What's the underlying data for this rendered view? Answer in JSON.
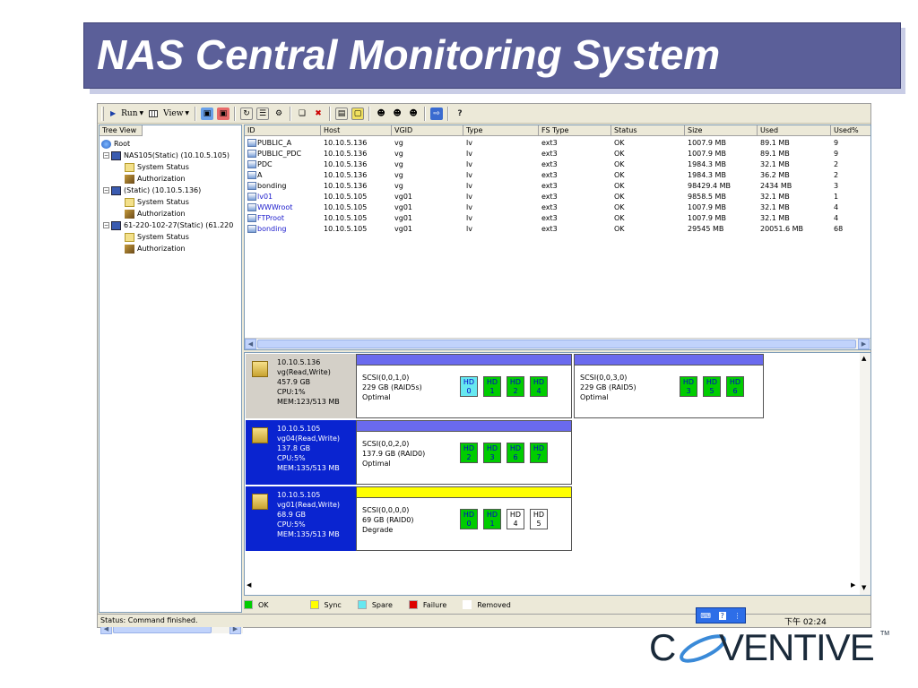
{
  "slide": {
    "title": "NAS Central Monitoring System"
  },
  "toolbar": {
    "run_label": "Run",
    "view_label": "View"
  },
  "tree": {
    "header": "Tree View",
    "items": [
      {
        "label": "Root"
      },
      {
        "label": "NAS105(Static) (10.10.5.105)"
      },
      {
        "label": "System Status"
      },
      {
        "label": "Authorization"
      },
      {
        "label": "(Static) (10.10.5.136)"
      },
      {
        "label": "System Status"
      },
      {
        "label": "Authorization"
      },
      {
        "label": "61-220-102-27(Static) (61.220"
      },
      {
        "label": "System Status"
      },
      {
        "label": "Authorization"
      }
    ]
  },
  "table": {
    "columns": [
      "ID",
      "Host",
      "VGID",
      "Type",
      "FS Type",
      "Status",
      "Size",
      "Used",
      "Used%"
    ],
    "rows": [
      [
        "PUBLIC_A",
        "10.10.5.136",
        "vg",
        "lv",
        "ext3",
        "OK",
        "1007.9 MB",
        "89.1 MB",
        "9"
      ],
      [
        "PUBLIC_PDC",
        "10.10.5.136",
        "vg",
        "lv",
        "ext3",
        "OK",
        "1007.9 MB",
        "89.1 MB",
        "9"
      ],
      [
        "PDC",
        "10.10.5.136",
        "vg",
        "lv",
        "ext3",
        "OK",
        "1984.3 MB",
        "32.1 MB",
        "2"
      ],
      [
        "A",
        "10.10.5.136",
        "vg",
        "lv",
        "ext3",
        "OK",
        "1984.3 MB",
        "36.2 MB",
        "2"
      ],
      [
        "bonding",
        "10.10.5.136",
        "vg",
        "lv",
        "ext3",
        "OK",
        "98429.4 MB",
        "2434 MB",
        "3"
      ],
      [
        "lv01",
        "10.10.5.105",
        "vg01",
        "lv",
        "ext3",
        "OK",
        "9858.5 MB",
        "32.1 MB",
        "1"
      ],
      [
        "WWWroot",
        "10.10.5.105",
        "vg01",
        "lv",
        "ext3",
        "OK",
        "1007.9 MB",
        "32.1 MB",
        "4"
      ],
      [
        "FTProot",
        "10.10.5.105",
        "vg01",
        "lv",
        "ext3",
        "OK",
        "1007.9 MB",
        "32.1 MB",
        "4"
      ],
      [
        "bonding",
        "10.10.5.105",
        "vg01",
        "lv",
        "ext3",
        "OK",
        "29545 MB",
        "20051.6 MB",
        "68"
      ]
    ]
  },
  "vgs": [
    {
      "host": "10.10.5.136",
      "vg": "vg(Read,Write)",
      "size": "457.9 GB",
      "cpu": "CPU:1%",
      "mem": "MEM:123/513 MB"
    },
    {
      "host": "10.10.5.105",
      "vg": "vg04(Read,Write)",
      "size": "137.8 GB",
      "cpu": "CPU:5%",
      "mem": "MEM:135/513 MB"
    },
    {
      "host": "10.10.5.105",
      "vg": "vg01(Read,Write)",
      "size": "68.9 GB",
      "cpu": "CPU:5%",
      "mem": "MEM:135/513 MB"
    }
  ],
  "raids": [
    {
      "scsi": "SCSI(0,0,1,0)",
      "cap": "229 GB (RAID5s)",
      "state": "Optimal",
      "hds": [
        {
          "label": "HD",
          "num": "0"
        },
        {
          "label": "HD",
          "num": "1"
        },
        {
          "label": "HD",
          "num": "2"
        },
        {
          "label": "HD",
          "num": "4"
        }
      ]
    },
    {
      "scsi": "SCSI(0,0,3,0)",
      "cap": "229 GB (RAID5)",
      "state": "Optimal",
      "hds": [
        {
          "label": "HD",
          "num": "3"
        },
        {
          "label": "HD",
          "num": "5"
        },
        {
          "label": "HD",
          "num": "6"
        }
      ]
    },
    {
      "scsi": "SCSI(0,0,2,0)",
      "cap": "137.9 GB (RAID0)",
      "state": "Optimal",
      "hds": [
        {
          "label": "HD",
          "num": "2"
        },
        {
          "label": "HD",
          "num": "3"
        },
        {
          "label": "HD",
          "num": "6"
        },
        {
          "label": "HD",
          "num": "7"
        }
      ]
    },
    {
      "scsi": "SCSI(0,0,0,0)",
      "cap": "69 GB (RAID0)",
      "state": "Degrade",
      "hds": [
        {
          "label": "HD",
          "num": "0"
        },
        {
          "label": "HD",
          "num": "1"
        },
        {
          "label": "HD",
          "num": "4"
        },
        {
          "label": "HD",
          "num": "5"
        }
      ]
    }
  ],
  "legend": [
    {
      "label": "OK",
      "color": "#00cc00"
    },
    {
      "label": "Sync",
      "color": "#ffff00"
    },
    {
      "label": "Spare",
      "color": "#66e8f0"
    },
    {
      "label": "Failure",
      "color": "#dd0000"
    },
    {
      "label": "Removed",
      "color": "#ffffff"
    }
  ],
  "status": {
    "text": "Status: Command finished.",
    "clock": "下午 02:24"
  },
  "logo": {
    "text": "COVENTIVE",
    "tm": "TM"
  }
}
